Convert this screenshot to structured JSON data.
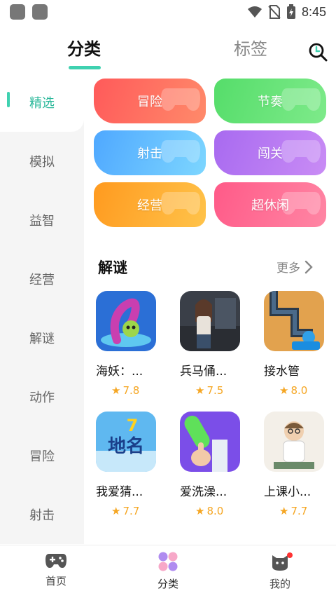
{
  "status_bar": {
    "time": "8:45"
  },
  "header": {
    "tabs": [
      {
        "label": "分类",
        "active": true
      },
      {
        "label": "标签",
        "active": false
      }
    ]
  },
  "sidebar": {
    "items": [
      {
        "label": "精选",
        "active": true
      },
      {
        "label": "模拟"
      },
      {
        "label": "益智"
      },
      {
        "label": "经营"
      },
      {
        "label": "解谜"
      },
      {
        "label": "动作"
      },
      {
        "label": "冒险"
      },
      {
        "label": "射击"
      }
    ]
  },
  "categories": [
    {
      "label": "冒险",
      "color_from": "#ff5a5a",
      "color_to": "#ff8a6a"
    },
    {
      "label": "节奏",
      "color_from": "#55dd6a",
      "color_to": "#7eea8a"
    },
    {
      "label": "射击",
      "color_from": "#4fa8ff",
      "color_to": "#7dd6ff"
    },
    {
      "label": "闯关",
      "color_from": "#a86af0",
      "color_to": "#c98cf5"
    },
    {
      "label": "经营",
      "color_from": "#ff9a1f",
      "color_to": "#ffc34a"
    },
    {
      "label": "超休闲",
      "color_from": "#ff5a88",
      "color_to": "#ff86a4"
    }
  ],
  "section": {
    "title": "解谜",
    "more_label": "更多"
  },
  "games": [
    {
      "name": "海妖：...",
      "rating": "7.8"
    },
    {
      "name": "兵马俑...",
      "rating": "7.5"
    },
    {
      "name": "接水管",
      "rating": "8.0"
    },
    {
      "name": "我爱猜...",
      "rating": "7.7"
    },
    {
      "name": "爱洗澡...",
      "rating": "8.0"
    },
    {
      "name": "上课小...",
      "rating": "7.7"
    }
  ],
  "game_icons": {
    "icon_4_text": "地名",
    "icon_4_badge": "7"
  },
  "bottom_nav": {
    "items": [
      {
        "label": "首页"
      },
      {
        "label": "分类",
        "active": true
      },
      {
        "label": "我的"
      }
    ]
  },
  "colors": {
    "accent": "#3fd1b0",
    "star": "#f5a623"
  }
}
